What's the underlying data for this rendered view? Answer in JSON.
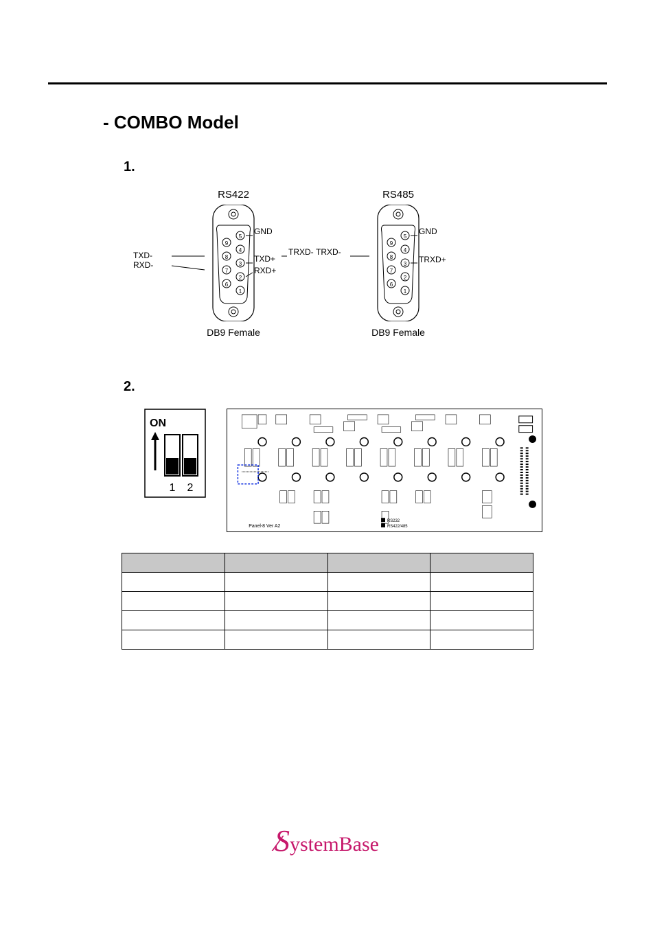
{
  "heading": "- COMBO Model",
  "section1_num": "1.",
  "section2_num": "2.",
  "connectors": [
    {
      "title": "RS422",
      "caption": "DB9 Female",
      "left_labels": [
        "TXD-",
        "RXD-"
      ],
      "right_labels": [
        "GND",
        "TXD+",
        "RXD+"
      ],
      "between_label": "TRXD-"
    },
    {
      "title": "RS485",
      "caption": "DB9 Female",
      "left_labels": [],
      "right_labels": [
        "GND",
        "TRXD+"
      ],
      "between_label": "TRXD-"
    }
  ],
  "dip": {
    "on_label": "ON",
    "pos1": "1",
    "pos2": "2"
  },
  "pcb": {
    "version_text": "Panel-8 Ver A2",
    "legend1": "RS232",
    "legend2": "RS422/485"
  },
  "table": {
    "headers": [
      "",
      "",
      "",
      ""
    ],
    "rows": [
      [
        "",
        "",
        "",
        ""
      ],
      [
        "",
        "",
        "",
        ""
      ],
      [
        "",
        "",
        "",
        ""
      ],
      [
        "",
        "",
        "",
        ""
      ]
    ]
  },
  "logo_text": "SystemBase"
}
